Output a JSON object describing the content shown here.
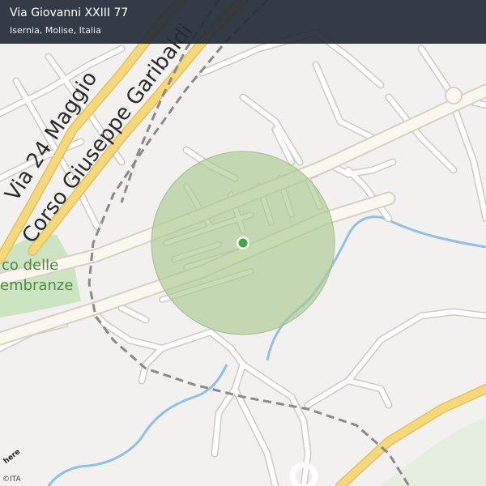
{
  "header": {
    "title": "Via Giovanni XXIII 77",
    "subtitle": "Isernia, Molise, Italia"
  },
  "map": {
    "street_labels": {
      "via_24_maggio": "Via 24 Maggio",
      "corso_garibaldi": "Corso Giuseppe Garibaldi"
    },
    "park_label_line1": "co delle",
    "park_label_line2": "embranze",
    "marker": "location-pin",
    "accuracy_circle": "accuracy-radius",
    "colors": {
      "background": "#f2f1f0",
      "major_road": "#f6d77a",
      "road": "#ffffff",
      "road_outline": "#cfcac3",
      "park": "#cde4c3",
      "water": "#8fc0e6",
      "railway": "#8a8a8a",
      "accuracy_fill": "#a9c990",
      "marker": "#3daa3d"
    }
  },
  "branding": {
    "logo": "here",
    "copyright": "©ITA"
  }
}
